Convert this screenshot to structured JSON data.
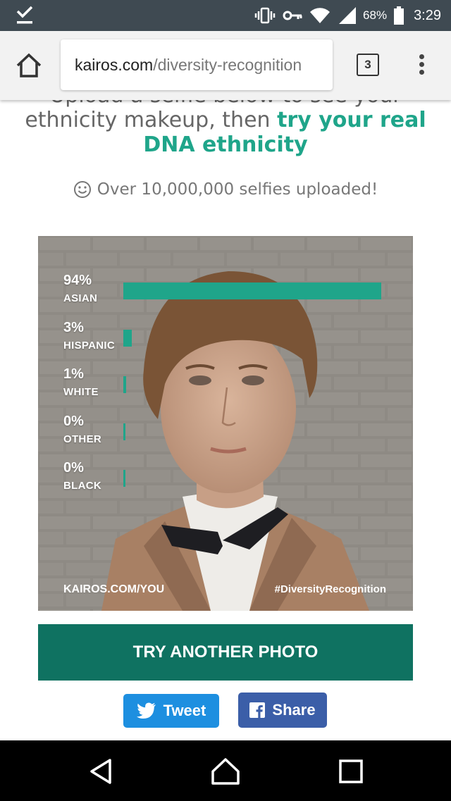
{
  "status_bar": {
    "battery_percent": "68%",
    "time": "3:29",
    "icons": [
      "download-done-icon",
      "vibrate-icon",
      "key-icon",
      "wifi-icon",
      "signal-icon",
      "battery-icon"
    ]
  },
  "browser": {
    "url_domain": "kairos.com",
    "url_path": "/diversity-recognition",
    "tab_count": "3",
    "icons": [
      "home-icon",
      "overflow-menu-icon"
    ]
  },
  "page": {
    "headline_cut": "Upload a selfie below to see your",
    "headline_plain": "ethnicity makeup, then ",
    "headline_link": "try your real DNA ethnicity",
    "selfie_counter": "Over 10,000,000 selfies uploaded!",
    "smiley_icon": "smiley-icon"
  },
  "result": {
    "ethnicities": [
      {
        "percent": "94%",
        "label": "ASIAN",
        "value": 94
      },
      {
        "percent": "3%",
        "label": "HISPANIC",
        "value": 3
      },
      {
        "percent": "1%",
        "label": "WHITE",
        "value": 1
      },
      {
        "percent": "0%",
        "label": "OTHER",
        "value": 0
      },
      {
        "percent": "0%",
        "label": "BLACK",
        "value": 0
      }
    ],
    "footer_left": "KAIROS.COM/YOU",
    "footer_right": "#DiversityRecognition",
    "bar_color": "#1fa58a"
  },
  "actions": {
    "try_another": "TRY ANOTHER PHOTO",
    "tweet": "Tweet",
    "share": "Share"
  },
  "nav_bar": {
    "icons": [
      "back-icon",
      "home-icon",
      "recents-icon"
    ]
  }
}
